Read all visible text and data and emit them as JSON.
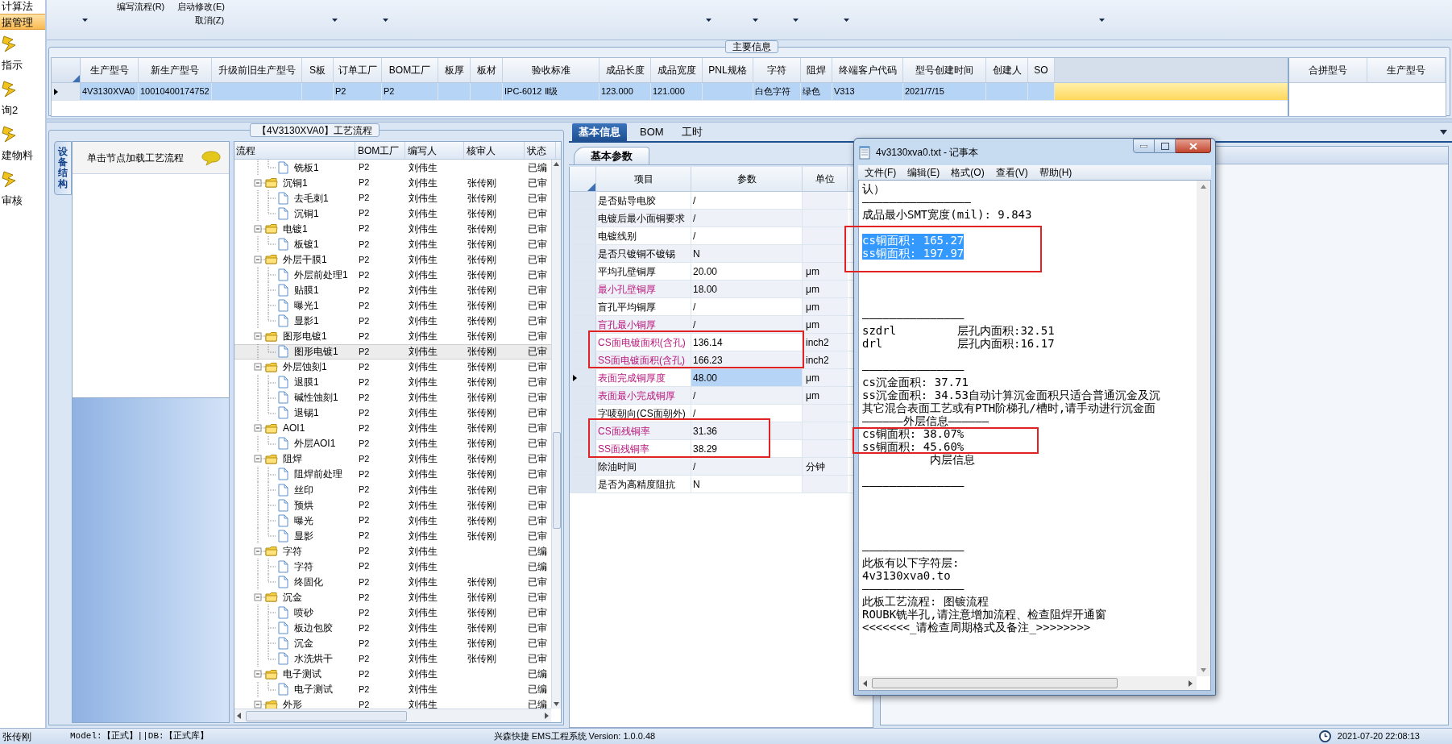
{
  "sidebar": {
    "items": [
      {
        "label": "计算法",
        "kind": "text",
        "selected": false
      },
      {
        "label": "据管理",
        "kind": "text",
        "selected": true
      },
      {
        "label": "指示",
        "kind": "icon",
        "selected": false
      },
      {
        "label": "询2",
        "kind": "icon",
        "selected": false
      },
      {
        "label": "建物料",
        "kind": "icon",
        "selected": false
      },
      {
        "label": "审核",
        "kind": "icon",
        "selected": false
      }
    ]
  },
  "ribbon": {
    "buttons": [
      "编写流程(R)",
      "启动修改(E)",
      "取消(Z)"
    ]
  },
  "main_info": {
    "title": "主要信息",
    "row_selected": true,
    "columns": [
      {
        "header": "生产型号",
        "value": "4V3130XVA0"
      },
      {
        "header": "新生产型号",
        "value": "10010400174752"
      },
      {
        "header": "升级前旧生产型号"
      },
      {
        "header": "S板"
      },
      {
        "header": "订单工厂",
        "value": "P2"
      },
      {
        "header": "BOM工厂",
        "value": "P2"
      },
      {
        "header": "板厚"
      },
      {
        "header": "板材"
      },
      {
        "header": "验收标准",
        "value": "IPC-6012 Ⅱ级"
      },
      {
        "header": "成品长度",
        "value": "123.000"
      },
      {
        "header": "成品宽度",
        "value": "121.000"
      },
      {
        "header": "PNL规格"
      },
      {
        "header": "字符",
        "value": "白色字符"
      },
      {
        "header": "阻焊",
        "value": "绿色"
      },
      {
        "header": "终端客户代码",
        "value": "V313"
      },
      {
        "header": "型号创建时间",
        "value": "2021/7/15"
      },
      {
        "header": "创建人"
      },
      {
        "header": "SO"
      }
    ],
    "merge_columns": [
      "合拼型号",
      "生产型号"
    ]
  },
  "process_panel": {
    "title": "【4V3130XVA0】工艺流程",
    "side_tab": "设备结构",
    "hint": "单击节点加载工艺流程",
    "columns": [
      "流程",
      "BOM工厂",
      "编写人",
      "核审人",
      "状态"
    ],
    "tree": [
      {
        "children": [
          {
            "name": "铣板1",
            "bom": "P2",
            "writer": "刘伟生",
            "status": "已编",
            "selected": false
          }
        ]
      },
      {
        "name": "沉铜1",
        "bom": "P2",
        "writer": "刘伟生",
        "reviewer": "张传刚",
        "status": "已审",
        "expanded": true,
        "selected": false,
        "children": [
          {
            "name": "去毛刺1",
            "bom": "P2",
            "writer": "刘伟生",
            "reviewer": "张传刚",
            "status": "已审",
            "selected": false
          },
          {
            "name": "沉铜1",
            "bom": "P2",
            "writer": "刘伟生",
            "reviewer": "张传刚",
            "status": "已审",
            "selected": false
          }
        ]
      },
      {
        "name": "电镀1",
        "bom": "P2",
        "writer": "刘伟生",
        "reviewer": "张传刚",
        "status": "已审",
        "expanded": true,
        "selected": false,
        "children": [
          {
            "name": "板镀1",
            "bom": "P2",
            "writer": "刘伟生",
            "reviewer": "张传刚",
            "status": "已审",
            "selected": false
          }
        ]
      },
      {
        "name": "外层干膜1",
        "bom": "P2",
        "writer": "刘伟生",
        "reviewer": "张传刚",
        "status": "已审",
        "expanded": true,
        "selected": false,
        "children": [
          {
            "name": "外层前处理1",
            "bom": "P2",
            "writer": "刘伟生",
            "reviewer": "张传刚",
            "status": "已审",
            "selected": false
          },
          {
            "name": "贴膜1",
            "bom": "P2",
            "writer": "刘伟生",
            "reviewer": "张传刚",
            "status": "已审",
            "selected": false
          },
          {
            "name": "曝光1",
            "bom": "P2",
            "writer": "刘伟生",
            "reviewer": "张传刚",
            "status": "已审",
            "selected": false
          },
          {
            "name": "显影1",
            "bom": "P2",
            "writer": "刘伟生",
            "reviewer": "张传刚",
            "status": "已审",
            "selected": false
          }
        ]
      },
      {
        "name": "图形电镀1",
        "bom": "P2",
        "writer": "刘伟生",
        "reviewer": "张传刚",
        "status": "已审",
        "expanded": true,
        "selected": false,
        "children": [
          {
            "name": "图形电镀1",
            "bom": "P2",
            "writer": "刘伟生",
            "reviewer": "张传刚",
            "status": "已审",
            "selected": true
          }
        ]
      },
      {
        "name": "外层蚀刻1",
        "bom": "P2",
        "writer": "刘伟生",
        "reviewer": "张传刚",
        "status": "已审",
        "expanded": true,
        "selected": false,
        "children": [
          {
            "name": "退膜1",
            "bom": "P2",
            "writer": "刘伟生",
            "reviewer": "张传刚",
            "status": "已审",
            "selected": false
          },
          {
            "name": "碱性蚀刻1",
            "bom": "P2",
            "writer": "刘伟生",
            "reviewer": "张传刚",
            "status": "已审",
            "selected": false
          },
          {
            "name": "退锡1",
            "bom": "P2",
            "writer": "刘伟生",
            "reviewer": "张传刚",
            "status": "已审",
            "selected": false
          }
        ]
      },
      {
        "name": "AOI1",
        "bom": "P2",
        "writer": "刘伟生",
        "reviewer": "张传刚",
        "status": "已审",
        "expanded": true,
        "selected": false,
        "children": [
          {
            "name": "外层AOI1",
            "bom": "P2",
            "writer": "刘伟生",
            "reviewer": "张传刚",
            "status": "已审",
            "selected": false
          }
        ]
      },
      {
        "name": "阻焊",
        "bom": "P2",
        "writer": "刘伟生",
        "reviewer": "张传刚",
        "status": "已审",
        "expanded": true,
        "selected": false,
        "children": [
          {
            "name": "阻焊前处理",
            "bom": "P2",
            "writer": "刘伟生",
            "reviewer": "张传刚",
            "status": "已审",
            "selected": false
          },
          {
            "name": "丝印",
            "bom": "P2",
            "writer": "刘伟生",
            "reviewer": "张传刚",
            "status": "已审",
            "selected": false
          },
          {
            "name": "预烘",
            "bom": "P2",
            "writer": "刘伟生",
            "reviewer": "张传刚",
            "status": "已审",
            "selected": false
          },
          {
            "name": "曝光",
            "bom": "P2",
            "writer": "刘伟生",
            "reviewer": "张传刚",
            "status": "已审",
            "selected": false
          },
          {
            "name": "显影",
            "bom": "P2",
            "writer": "刘伟生",
            "reviewer": "张传刚",
            "status": "已审",
            "selected": false
          }
        ]
      },
      {
        "name": "字符",
        "bom": "P2",
        "writer": "刘伟生",
        "status": "已编",
        "expanded": true,
        "selected": false,
        "children": [
          {
            "name": "字符",
            "bom": "P2",
            "writer": "刘伟生",
            "status": "已编",
            "selected": false
          },
          {
            "name": "终固化",
            "bom": "P2",
            "writer": "刘伟生",
            "reviewer": "张传刚",
            "status": "已审",
            "selected": false
          }
        ]
      },
      {
        "name": "沉金",
        "bom": "P2",
        "writer": "刘伟生",
        "reviewer": "张传刚",
        "status": "已审",
        "expanded": true,
        "selected": false,
        "children": [
          {
            "name": "喷砂",
            "bom": "P2",
            "writer": "刘伟生",
            "reviewer": "张传刚",
            "status": "已审",
            "selected": false
          },
          {
            "name": "板边包胶",
            "bom": "P2",
            "writer": "刘伟生",
            "reviewer": "张传刚",
            "status": "已审",
            "selected": false
          },
          {
            "name": "沉金",
            "bom": "P2",
            "writer": "刘伟生",
            "reviewer": "张传刚",
            "status": "已审",
            "selected": false
          },
          {
            "name": "水洗烘干",
            "bom": "P2",
            "writer": "刘伟生",
            "reviewer": "张传刚",
            "status": "已审",
            "selected": false
          }
        ]
      },
      {
        "name": "电子测试",
        "bom": "P2",
        "writer": "刘伟生",
        "status": "已编",
        "expanded": true,
        "selected": false,
        "children": [
          {
            "name": "电子测试",
            "bom": "P2",
            "writer": "刘伟生",
            "status": "已编",
            "selected": false
          }
        ]
      },
      {
        "name": "外形",
        "bom": "P2",
        "writer": "刘伟生",
        "status": "已编",
        "expanded": true,
        "selected": false
      }
    ]
  },
  "params_panel": {
    "tabs": [
      {
        "label": "基本信息",
        "selected": true
      },
      {
        "label": "BOM",
        "selected": false
      },
      {
        "label": "工时",
        "selected": false
      }
    ],
    "subtab": "基本参数",
    "columns": [
      "项目",
      "参数",
      "单位"
    ],
    "rows": [
      {
        "item": "是否贴导电胶",
        "value": "/",
        "highlighted": false,
        "selected": false
      },
      {
        "item": "电镀后最小面铜要求",
        "value": "/",
        "highlighted": false,
        "selected": false
      },
      {
        "item": "电镀线别",
        "value": "/",
        "highlighted": false,
        "selected": false
      },
      {
        "item": "是否只镀铜不镀锡",
        "value": "N",
        "highlighted": false,
        "selected": false
      },
      {
        "item": "平均孔壁铜厚",
        "value": "20.00",
        "unit": "μm",
        "highlighted": false,
        "selected": false
      },
      {
        "item": "最小孔壁铜厚",
        "value": "18.00",
        "unit": "μm",
        "highlighted": true,
        "selected": false
      },
      {
        "item": "盲孔平均铜厚",
        "value": "/",
        "unit": "μm",
        "highlighted": false,
        "selected": false
      },
      {
        "item": "盲孔最小铜厚",
        "value": "/",
        "unit": "μm",
        "highlighted": true,
        "selected": false
      },
      {
        "item": "CS面电镀面积(含孔)",
        "value": "136.14",
        "unit": "inch2",
        "highlighted": true,
        "selected": false
      },
      {
        "item": "SS面电镀面积(含孔)",
        "value": "166.23",
        "unit": "inch2",
        "highlighted": true,
        "selected": false
      },
      {
        "item": "表面完成铜厚度",
        "value": "48.00",
        "unit": "μm",
        "highlighted": true,
        "selected": true
      },
      {
        "item": "表面最小完成铜厚",
        "value": "/",
        "unit": "μm",
        "highlighted": true,
        "selected": false
      },
      {
        "item": "字唛朝向(CS面朝外)",
        "value": "/",
        "highlighted": false,
        "selected": false
      },
      {
        "item": "CS面残铜率",
        "value": "31.36",
        "highlighted": true,
        "selected": false
      },
      {
        "item": "SS面残铜率",
        "value": "38.29",
        "highlighted": true,
        "selected": false
      },
      {
        "item": "除油时间",
        "value": "/",
        "unit": "分钟",
        "highlighted": false,
        "selected": false
      },
      {
        "item": "是否为高精度阻抗",
        "value": "N",
        "highlighted": false,
        "selected": false
      }
    ]
  },
  "notepad": {
    "title": "4v3130xva0.txt - 记事本",
    "menu": [
      "文件(F)",
      "编辑(E)",
      "格式(O)",
      "查看(V)",
      "帮助(H)"
    ],
    "lines": [
      {
        "kind": "text",
        "text": "认）",
        "selected": false
      },
      {
        "kind": "text",
        "text": "————————————————",
        "selected": false
      },
      {
        "kind": "text",
        "text": "成品最小SMT宽度(mil): 9.843",
        "selected": false
      },
      {
        "kind": "blank"
      },
      {
        "kind": "text",
        "text": "cs铜面积: 165.27",
        "selected": true
      },
      {
        "kind": "text",
        "text": "ss铜面积: 197.97",
        "selected": true
      },
      {
        "kind": "blank"
      },
      {
        "kind": "blank"
      },
      {
        "kind": "blank"
      },
      {
        "kind": "blank"
      },
      {
        "kind": "text",
        "text": "———————————————",
        "selected": false
      },
      {
        "kind": "text",
        "text": "szdrl         层孔内面积:32.51",
        "selected": false
      },
      {
        "kind": "text",
        "text": "drl           层孔内面积:16.17",
        "selected": false
      },
      {
        "kind": "blank"
      },
      {
        "kind": "text",
        "text": "———————————————",
        "selected": false
      },
      {
        "kind": "text",
        "text": "cs沉金面积: 37.71",
        "selected": false
      },
      {
        "kind": "text",
        "text": "ss沉金面积: 34.53自动计算沉金面积只适合普通沉金及沉",
        "selected": false
      },
      {
        "kind": "text",
        "text": "其它混合表面工艺或有PTH阶梯孔/槽时,请手动进行沉金面",
        "selected": false
      },
      {
        "kind": "text",
        "text": "——————外层信息——————",
        "selected": false
      },
      {
        "kind": "text",
        "text": "cs铜面积: 38.07%",
        "selected": false
      },
      {
        "kind": "text",
        "text": "ss铜面积: 45.60%",
        "selected": false
      },
      {
        "kind": "text",
        "text": "          内层信息",
        "selected": false
      },
      {
        "kind": "blank"
      },
      {
        "kind": "text",
        "text": "———————————————",
        "selected": false
      },
      {
        "kind": "blank"
      },
      {
        "kind": "blank"
      },
      {
        "kind": "blank"
      },
      {
        "kind": "blank"
      },
      {
        "kind": "text",
        "text": "———————————————",
        "selected": false
      },
      {
        "kind": "text",
        "text": "此板有以下字符层:",
        "selected": false
      },
      {
        "kind": "text",
        "text": "4v3130xva0.to",
        "selected": false
      },
      {
        "kind": "text",
        "text": "———————————————",
        "selected": false
      },
      {
        "kind": "text",
        "text": "此板工艺流程: 图镀流程",
        "selected": false
      },
      {
        "kind": "text",
        "text": "ROUBK铣半孔,请注意增加流程、检查阻焊开通窗",
        "selected": false
      },
      {
        "kind": "text",
        "text": "<<<<<<<_请检查周期格式及备注_>>>>>>>>",
        "selected": false
      }
    ]
  },
  "status_bar": {
    "user": "张传刚",
    "model": "Model:【正式】||DB:【正式库】",
    "app": "兴森快捷 EMS工程系统 Version: 1.0.0.48",
    "datetime": "2021-07-20 22:08:13"
  }
}
